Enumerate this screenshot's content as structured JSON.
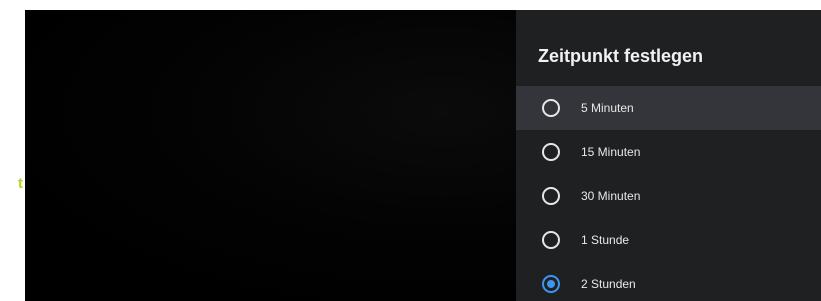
{
  "left_edge": {
    "text": "t",
    "color": "#b7d31e"
  },
  "panel": {
    "title": "Zeitpunkt festlegen",
    "options": [
      {
        "label": "5 Minuten",
        "selected": false,
        "focused": true
      },
      {
        "label": "15 Minuten",
        "selected": false,
        "focused": false
      },
      {
        "label": "30 Minuten",
        "selected": false,
        "focused": false
      },
      {
        "label": "1 Stunde",
        "selected": false,
        "focused": false
      },
      {
        "label": "2 Stunden",
        "selected": true,
        "focused": false
      }
    ],
    "accent_color": "#3d95f0"
  }
}
